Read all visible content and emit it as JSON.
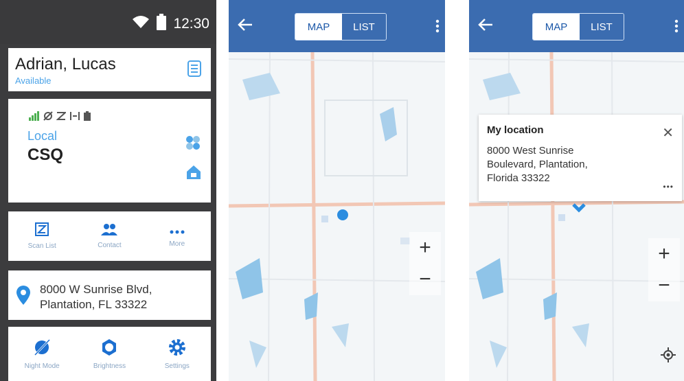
{
  "colors": {
    "accent_blue": "#4ba3e8",
    "app_bar": "#3b6cb0",
    "status_bar": "#3a3a3c",
    "map_road": "#f2c7b5",
    "map_water": "#8fc4e8"
  },
  "home": {
    "status_time": "12:30",
    "user_name": "Adrian, Lucas",
    "user_status": "Available",
    "channel_label": "Local",
    "channel_name": "CSQ",
    "actions": [
      {
        "label": "Scan List",
        "icon": "scan-list-icon"
      },
      {
        "label": "Contact",
        "icon": "contact-icon"
      },
      {
        "label": "More",
        "icon": "more-icon"
      }
    ],
    "address_line1": "8000 W Sunrise Blvd,",
    "address_line2": "Plantation, FL 33322",
    "bottom": [
      {
        "label": "Night Mode",
        "icon": "night-mode-icon"
      },
      {
        "label": "Brightness",
        "icon": "brightness-icon"
      },
      {
        "label": "Settings",
        "icon": "settings-icon"
      }
    ]
  },
  "map1": {
    "tab_map": "MAP",
    "tab_list": "LIST",
    "zoom_in": "+",
    "zoom_out": "−"
  },
  "map2": {
    "tab_map": "MAP",
    "tab_list": "LIST",
    "zoom_in": "+",
    "zoom_out": "−",
    "popup_title": "My location",
    "popup_line1": "8000 West Sunrise",
    "popup_line2": "Boulevard, Plantation,",
    "popup_line3": "Florida 33322",
    "popup_close": "✕",
    "popup_more": "•••"
  }
}
